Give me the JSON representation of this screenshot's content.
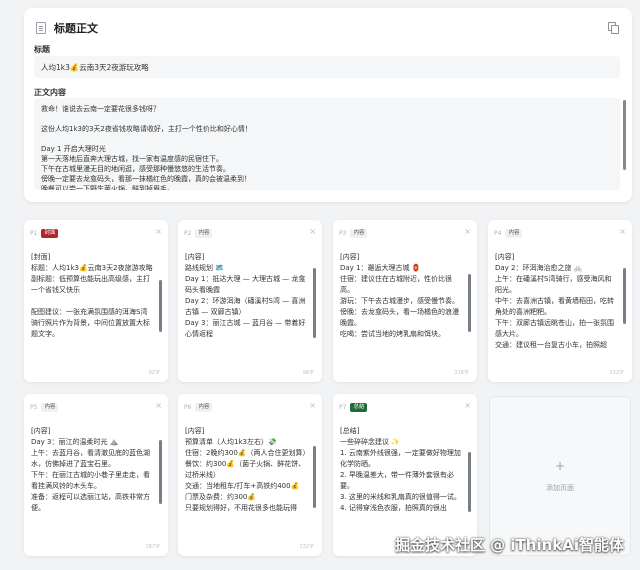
{
  "editor": {
    "header": {
      "title": "标题正文",
      "icon": "document-icon",
      "copy_icon": "copy-icon"
    },
    "title_label": "标题",
    "title_value": "人均1k3💰云南3天2夜游玩攻略",
    "content_label": "正文内容",
    "content_lines": [
      "救命！谁说去云南一定要花很多钱呀？",
      "",
      "这份人均1k3的3天2夜省钱攻略请收好，主打一个性价比和好心情！",
      "",
      "Day 1 开启大理时光",
      "第一天落地后直奔大理古城，找一家有温度感的民宿住下。",
      "下午在古城里漫无目的地闲逛，感受那种慢悠悠的生活节奏。",
      "傍晚一定要去龙龛码头，看那一抹橘红色的晚霞，真的会被温柔到！",
      "晚餐可以尝一下野生菌火锅，鲜到掉眉毛。"
    ]
  },
  "cards": [
    {
      "num": "P1",
      "tag": "封面",
      "tag_type": "cover",
      "word_count": "92字",
      "lines": [
        "[封面]",
        "标题：人均1k3💰云南3天2夜旅游攻略",
        "副标题：低预算也能玩出高级感，主打一个省钱又快乐",
        "",
        "配图建议：一张充满氛围感的洱海S湾骑行照片作为背景，中间位置放置大标题文字。"
      ]
    },
    {
      "num": "P2",
      "tag": "内容",
      "tag_type": "content",
      "word_count": "98字",
      "lines": [
        "[内容]",
        "路线规划 🗺️",
        "Day 1：抵达大理 — 大理古城 — 龙龛码头看晚霞",
        "Day 2：环游洱海（磻溪村S湾 — 喜洲古镇 — 双廊古镇）",
        "Day 3：丽江古城 — 蓝月谷 — 带着好心情返程"
      ]
    },
    {
      "num": "P3",
      "tag": "内容",
      "tag_type": "content",
      "word_count": "216字",
      "lines": [
        "[内容]",
        "Day 1：邂逅大理古城 🏮",
        "住宿：建议住在古城附近，性价比很高。",
        "游玩：下午去古城漫步，感受慢节奏。",
        "傍晚：去龙龛码头，看一场橘色的浪漫晚霞。",
        "吃喝：尝试当地的烤乳扇和饵块。"
      ]
    },
    {
      "num": "P4",
      "tag": "内容",
      "tag_type": "content",
      "word_count": "232字",
      "lines": [
        "[内容]",
        "Day 2：环洱海治愈之旅 🚲",
        "上午：在磻溪村S湾骑行，感受海风和阳光。",
        "中午：去喜洲古镇，看黄墙稻田，吃转角处的喜洲粑粑。",
        "下午：双廊古镇远眺苍山，拍一张氛围感大片。",
        "交通：建议租一台复古小车，拍照超"
      ]
    },
    {
      "num": "P5",
      "tag": "内容",
      "tag_type": "content",
      "word_count": "187字",
      "lines": [
        "[内容]",
        "Day 3：丽江的温柔时光 ⛰️",
        "上午：去蓝月谷，看清澈见底的蓝色湖水，仿佛掉进了蓝宝石里。",
        "下午：在丽江古城的小巷子里走走，看看挂满风铃的木头车。",
        "准备：返程可以选丽江站，高铁非常方便。"
      ]
    },
    {
      "num": "P6",
      "tag": "内容",
      "tag_type": "content",
      "word_count": "232字",
      "lines": [
        "[内容]",
        "预算清单（人均1k3左右）💸",
        "住宿：2晚约300💰（两人合住更划算）",
        "餐饮：约300💰（菌子火锅、鲜花饼、过桥米线）",
        "交通：当地租车/打车+高铁约400💰",
        "门票及杂费：约300💰",
        "只要规划得好，不用花很多也能玩得"
      ]
    },
    {
      "num": "P7",
      "tag": "总结",
      "tag_type": "summary",
      "word_count": "205字",
      "lines": [
        "[总结]",
        "一些碎碎念建议 ✨",
        "1. 云南紫外线很强，一定要做好物理加化学防晒。",
        "2. 早晚温差大，带一件薄外套很有必要。",
        "3. 这里的米线和乳扇真的很值得一试。",
        "4. 记得穿浅色衣服，拍照真的很出"
      ]
    }
  ],
  "add_page": {
    "label": "添加页面",
    "icon": "plus-icon"
  },
  "watermark": "掘金技术社区 @ iThinkAi智能体"
}
